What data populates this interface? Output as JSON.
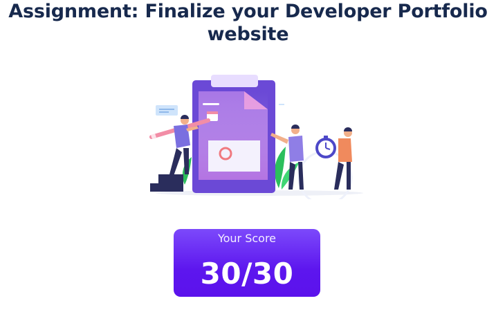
{
  "assignment": {
    "title": "Assignment: Finalize your Developer Portfolio website"
  },
  "illustration": {
    "icon": "clipboard-team-illustration"
  },
  "score": {
    "label": "Your Score",
    "value": "30/30"
  },
  "colors": {
    "title": "#17294d",
    "score_card_top": "#7c49fb",
    "score_card_bottom": "#5b12ec",
    "score_text": "#ffffff"
  }
}
